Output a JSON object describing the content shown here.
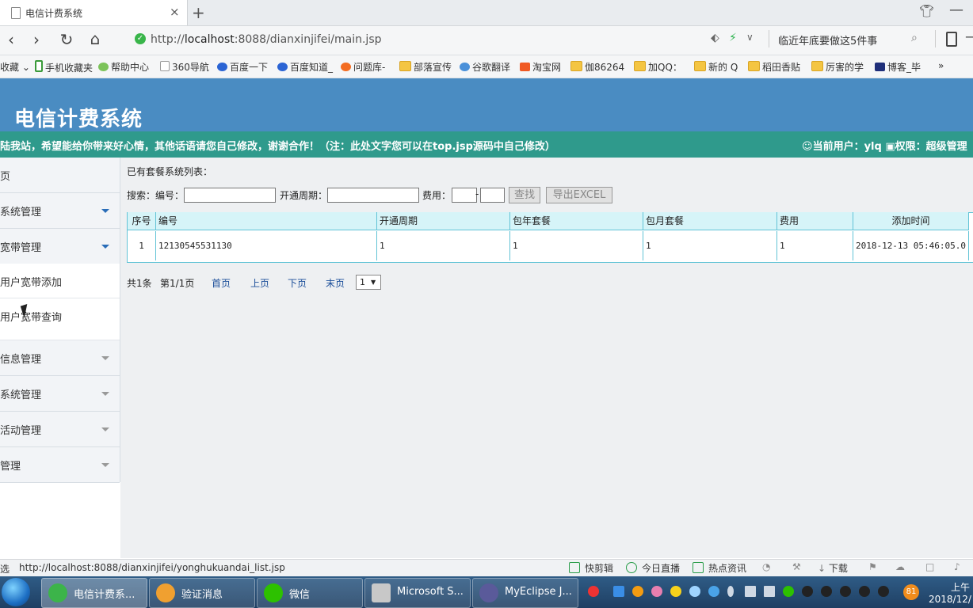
{
  "browser": {
    "tab_title": "电信计费系统",
    "tab_close": "×",
    "new_tab": "+",
    "url_prefix": "http://",
    "url_host": "localhost",
    "url_rest": ":8088/dianxinjifei/main.jsp",
    "hot_news": "临近年底要做这5件事",
    "bookmarks": [
      {
        "label": "收藏 ⌄",
        "icon": "none"
      },
      {
        "label": "手机收藏夹",
        "icon": "phone"
      },
      {
        "label": "帮助中心",
        "icon": "help"
      },
      {
        "label": "360导航",
        "icon": "page"
      },
      {
        "label": "百度一下",
        "icon": "baidu"
      },
      {
        "label": "百度知道_",
        "icon": "baidu"
      },
      {
        "label": "问题库-",
        "icon": "sogou"
      },
      {
        "label": "部落宣传",
        "icon": "folder"
      },
      {
        "label": "谷歌翻译",
        "icon": "translate"
      },
      {
        "label": "淘宝网",
        "icon": "taobao"
      },
      {
        "label": "伽86264",
        "icon": "folder"
      },
      {
        "label": "加QQ：",
        "icon": "folder"
      },
      {
        "label": "新的 Q",
        "icon": "folder"
      },
      {
        "label": "稻田香贴",
        "icon": "folder"
      },
      {
        "label": "厉害的学",
        "icon": "folder"
      },
      {
        "label": "博客_毕",
        "icon": "paw"
      }
    ],
    "bookmarks_more": "»",
    "status_left": "选",
    "status_url": "http://localhost:8088/dianxinjifei/yonghukuandai_list.jsp",
    "status_items": [
      "快剪辑",
      "今日直播",
      "热点资讯",
      "下载"
    ]
  },
  "app": {
    "title": "电信计费系统",
    "marquee": "陆我站，希望能给你带来好心情，其他话语请您自己修改，谢谢合作！（注：此处文字您可以在top.jsp源码中自己修改）",
    "user_label": "当前用户：",
    "user_name": "ylq",
    "perm_label": "权限：",
    "perm_value": "超级管理"
  },
  "sidebar": {
    "items": [
      {
        "label": "页",
        "caret": "none"
      },
      {
        "label": "系统管理",
        "caret": "blue"
      },
      {
        "label": "宽带管理",
        "caret": "blue"
      },
      {
        "label": "用户宽带添加",
        "caret": "sub"
      },
      {
        "label": "用户宽带查询",
        "caret": "sub"
      },
      {
        "label": "信息管理",
        "caret": "gray"
      },
      {
        "label": "系统管理",
        "caret": "gray"
      },
      {
        "label": "活动管理",
        "caret": "gray"
      },
      {
        "label": "管理",
        "caret": "gray"
      }
    ]
  },
  "main": {
    "list_title": "已有套餐系统列表：",
    "search_label": "搜索：编号：",
    "period_label": "开通周期：",
    "fee_label": "费用：",
    "fee_sep": "-",
    "search_button": "查找",
    "export_button": "导出EXCEL",
    "columns": [
      "序号",
      "编号",
      "开通周期",
      "包年套餐",
      "包月套餐",
      "费用",
      "添加时间"
    ],
    "rows": [
      [
        "1",
        "12130545531130",
        "1",
        "1",
        "1",
        "1",
        "2018-12-13 05:46:05.0"
      ]
    ],
    "pager": {
      "total": "共1条",
      "page": "第1/1页",
      "first": "首页",
      "prev": "上页",
      "next": "下页",
      "last": "末页",
      "select_value": "1"
    }
  },
  "taskbar": {
    "tasks": [
      "电信计费系...",
      "验证消息",
      "微信",
      "Microsoft S...",
      "MyEclipse J..."
    ],
    "tray_badge": "81",
    "clock_line1": "上午",
    "clock_line2": "2018/12/"
  }
}
